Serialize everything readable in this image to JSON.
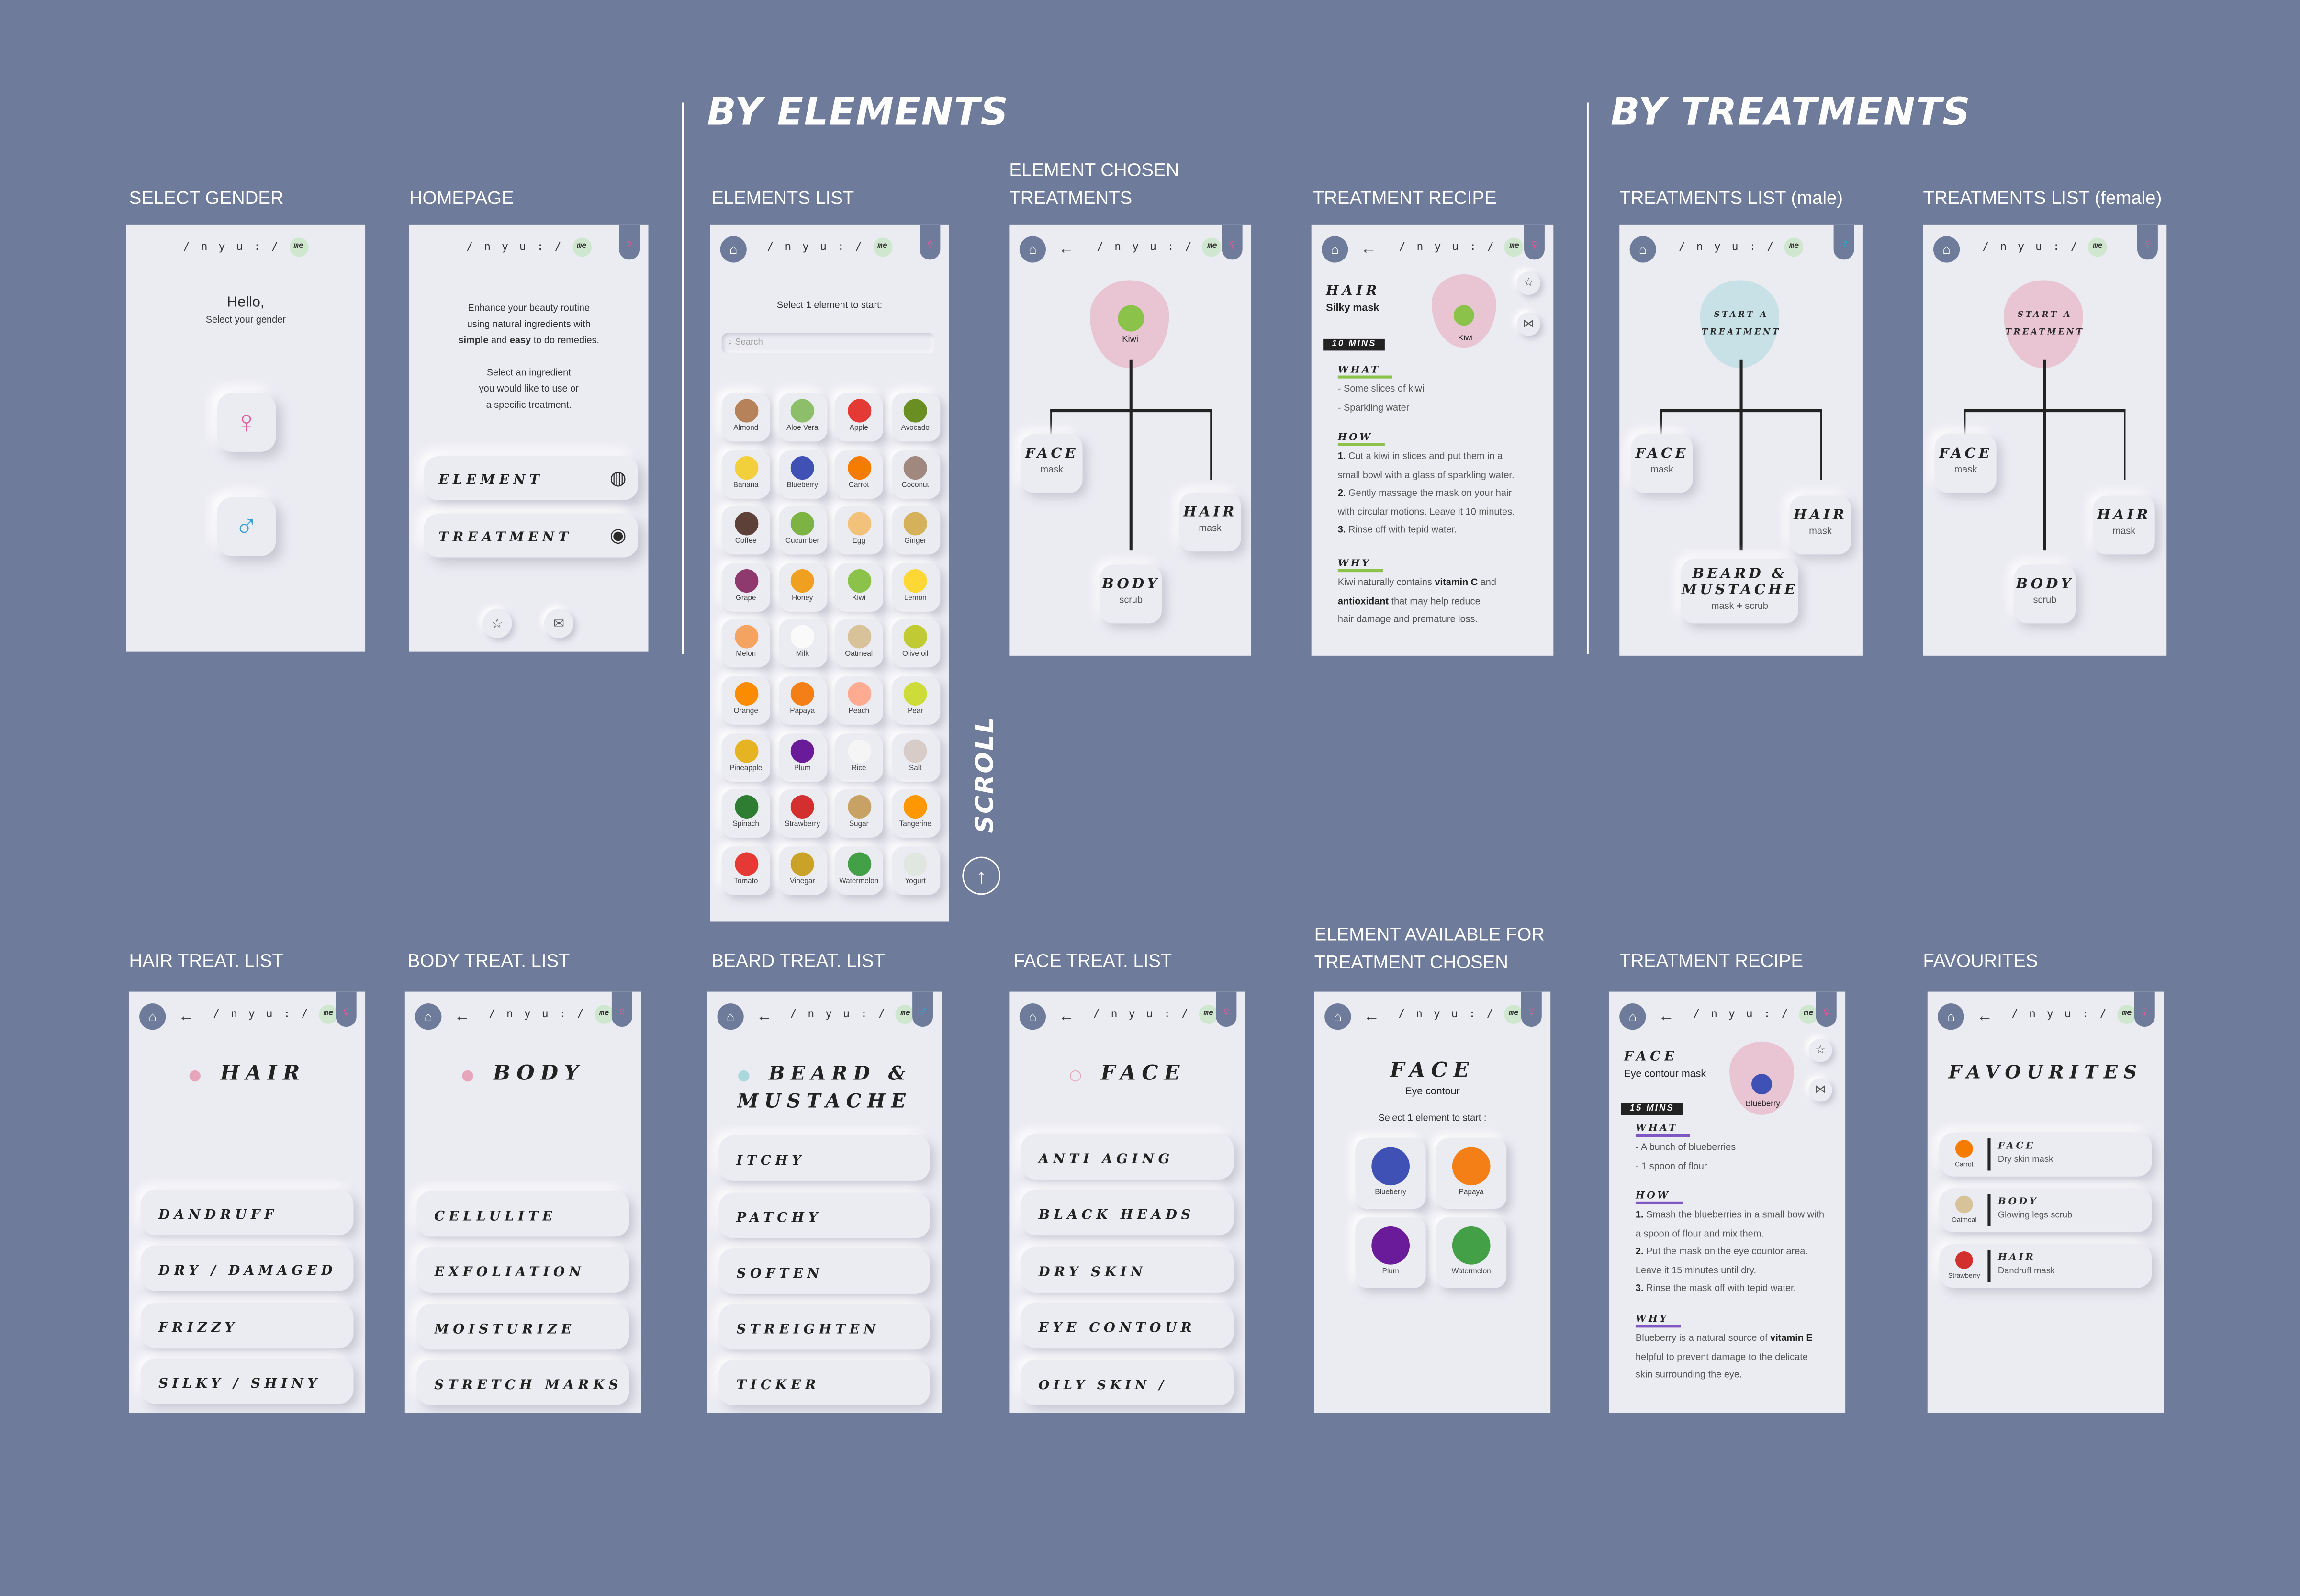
{
  "sections": {
    "by_elements": "BY ELEMENTS",
    "by_treatments": "BY TREATMENTS",
    "scroll": "SCROLL"
  },
  "captions": {
    "select_gender": "SELECT GENDER",
    "homepage": "HOMEPAGE",
    "elements_list": "ELEMENTS LIST",
    "element_chosen": "ELEMENT CHOSEN TREATMENTS",
    "recipe": "TREATMENT RECIPE",
    "treat_male": "TREATMENTS LIST (male)",
    "treat_female": "TREATMENTS LIST (female)",
    "hair_list": "HAIR TREAT. LIST",
    "body_list": "BODY TREAT. LIST",
    "beard_list": "BEARD TREAT. LIST",
    "face_list": "FACE TREAT. LIST",
    "element_available": "ELEMENT AVAILABLE FOR TREATMENT CHOSEN",
    "recipe2": "TREATMENT RECIPE",
    "favourites": "FAVOURITES"
  },
  "logo": {
    "left": "/ n y u : /",
    "right": "me"
  },
  "icons": {
    "home": "home-icon",
    "back": "arrow-left-icon",
    "female": "female-icon",
    "male": "male-icon",
    "star": "star-icon",
    "mail": "mail-icon",
    "share": "share-icon",
    "search": "search-icon",
    "eye": "eye-icon",
    "arrow_up": "arrow-up-icon"
  },
  "colors": {
    "background": "#6f7b9a",
    "screen": "#ebebf2",
    "female": "#e35b9a",
    "male": "#3b9fd1",
    "accent": "#8bc34a"
  },
  "gender": {
    "hello": "Hello,",
    "prompt": "Select your gender",
    "female": "♀",
    "male": "♂"
  },
  "home": {
    "intro1": "Enhance your beauty routine",
    "intro2": "using natural ingredients with",
    "intro3_b1": "simple",
    "intro3_m": "and",
    "intro3_b2": "easy",
    "intro3_e": "to do remedies.",
    "intro4": "Select an ingredient",
    "intro5": "you would like to use or",
    "intro6": "a specific treatment.",
    "element": "ELEMENT",
    "treatment": "TREATMENT"
  },
  "elements": {
    "prompt_a": "Select",
    "prompt_n": "1",
    "prompt_b": "element to start:",
    "search": "Search",
    "items": [
      {
        "n": "Almond",
        "c": "#b5825a"
      },
      {
        "n": "Aloe Vera",
        "c": "#8dbf6a"
      },
      {
        "n": "Apple",
        "c": "#e53935"
      },
      {
        "n": "Avocado",
        "c": "#6b8e23"
      },
      {
        "n": "Banana",
        "c": "#f2d03b"
      },
      {
        "n": "Blueberry",
        "c": "#3f51b5"
      },
      {
        "n": "Carrot",
        "c": "#f57c00"
      },
      {
        "n": "Coconut",
        "c": "#a1887f"
      },
      {
        "n": "Coffee",
        "c": "#5d4037"
      },
      {
        "n": "Cucumber",
        "c": "#7cb342"
      },
      {
        "n": "Egg",
        "c": "#f2c27b"
      },
      {
        "n": "Ginger",
        "c": "#d4b15a"
      },
      {
        "n": "Grape",
        "c": "#8e3a6e"
      },
      {
        "n": "Honey",
        "c": "#f0a020"
      },
      {
        "n": "Kiwi",
        "c": "#8bc34a"
      },
      {
        "n": "Lemon",
        "c": "#fdd835"
      },
      {
        "n": "Melon",
        "c": "#f4a460"
      },
      {
        "n": "Milk",
        "c": "#fafafa"
      },
      {
        "n": "Oatmeal",
        "c": "#d7c29a"
      },
      {
        "n": "Olive oil",
        "c": "#c0ca33"
      },
      {
        "n": "Orange",
        "c": "#fb8c00"
      },
      {
        "n": "Papaya",
        "c": "#f57f17"
      },
      {
        "n": "Peach",
        "c": "#ffab91"
      },
      {
        "n": "Pear",
        "c": "#cddc39"
      },
      {
        "n": "Pineapple",
        "c": "#e6b422"
      },
      {
        "n": "Plum",
        "c": "#6a1b9a"
      },
      {
        "n": "Rice",
        "c": "#f5f5f5"
      },
      {
        "n": "Salt",
        "c": "#d7ccc8"
      },
      {
        "n": "Spinach",
        "c": "#2e7d32"
      },
      {
        "n": "Strawberry",
        "c": "#d32f2f"
      },
      {
        "n": "Sugar",
        "c": "#c8a165"
      },
      {
        "n": "Tangerine",
        "c": "#ff9800"
      },
      {
        "n": "Tomato",
        "c": "#e53935"
      },
      {
        "n": "Vinegar",
        "c": "#c9a227"
      },
      {
        "n": "Watermelon",
        "c": "#43a047"
      },
      {
        "n": "Yogurt",
        "c": "#e0e6e0"
      }
    ]
  },
  "chosen": {
    "kiwi": "Kiwi",
    "face": "FACE",
    "face_sub": "mask",
    "hair": "HAIR",
    "hair_sub": "mask",
    "body": "BODY",
    "body_sub": "scrub"
  },
  "recipe": {
    "title": "HAIR",
    "sub": "Silky mask",
    "mins": "10 MINS",
    "kiwi": "Kiwi",
    "what": "WHAT",
    "what1": "- Some slices of kiwi",
    "what2": "- Sparkling water",
    "how": "HOW",
    "h1n": "1.",
    "h1a": "Cut a kiwi in slices and put them in a",
    "h1b": "small bowl with a glass of sparkling water.",
    "h2n": "2.",
    "h2a": "Gently massage the mask on your hair",
    "h2b": "with circular motions. Leave it 10 minutes.",
    "h3n": "3.",
    "h3a": "Rinse off with tepid water.",
    "why": "WHY",
    "w1a": "Kiwi naturally contains",
    "w1b": "vitamin C",
    "w1c": "and",
    "w2a": "antioxidant",
    "w2b": "that may help reduce",
    "w3": "hair damage and premature loss."
  },
  "treat": {
    "start1": "START A",
    "start2": "TREATMENT",
    "face": "FACE",
    "face_sub": "mask",
    "hair": "HAIR",
    "hair_sub": "mask",
    "beard1": "BEARD &",
    "beard2": "MUSTACHE",
    "beard_sub_a": "mask",
    "beard_sub_plus": "+",
    "beard_sub_b": "scrub",
    "body": "BODY",
    "body_sub": "scrub"
  },
  "hairlist": {
    "title": "HAIR",
    "items": [
      "DANDRUFF",
      "DRY / DAMAGED",
      "FRIZZY",
      "SILKY / SHINY"
    ]
  },
  "bodylist": {
    "title": "BODY",
    "items": [
      "CELLULITE",
      "EXFOLIATION",
      "MOISTURIZE",
      "STRETCH MARKS"
    ]
  },
  "beardlist": {
    "title1": "BEARD &",
    "title2": "MUSTACHE",
    "items": [
      "ITCHY",
      "PATCHY",
      "SOFTEN",
      "STREIGHTEN",
      "TICKER"
    ]
  },
  "facelist": {
    "title": "FACE",
    "items": [
      "ANTI AGING",
      "BLACK HEADS",
      "DRY SKIN",
      "EYE CONTOUR",
      "OILY SKIN / PIMPLES"
    ]
  },
  "avail": {
    "title": "FACE",
    "sub": "Eye contour",
    "prompt_a": "Select",
    "prompt_n": "1",
    "prompt_b": "element to start :",
    "items": [
      {
        "n": "Blueberry",
        "c": "#3f51b5"
      },
      {
        "n": "Papaya",
        "c": "#f57f17"
      },
      {
        "n": "Plum",
        "c": "#6a1b9a"
      },
      {
        "n": "Watermelon",
        "c": "#43a047"
      }
    ]
  },
  "recipe2": {
    "title": "FACE",
    "sub": "Eye contour mask",
    "mins": "15 MINS",
    "blueberry": "Blueberry",
    "what": "WHAT",
    "what1": "- A bunch of blueberries",
    "what2": "- 1 spoon of flour",
    "how": "HOW",
    "h1n": "1.",
    "h1a": "Smash the blueberries in a small bow with",
    "h1b": "a spoon of flour and mix them.",
    "h2n": "2.",
    "h2a": "Put the mask on the eye countor area.",
    "h2b": "Leave it 15 minutes until dry.",
    "h3n": "3.",
    "h3a": "Rinse the mask off with tepid water.",
    "why": "WHY",
    "w1a": "Blueberry is a natural source of",
    "w1b": "vitamin E",
    "w2": "helpful to prevent damage to the delicate",
    "w3": "skin surrounding the eye."
  },
  "fav": {
    "title": "FAVOURITES",
    "items": [
      {
        "el": "Carrot",
        "c": "#f57c00",
        "t": "FACE",
        "s": "Dry skin mask"
      },
      {
        "el": "Oatmeal",
        "c": "#d7c29a",
        "t": "BODY",
        "s": "Glowing legs scrub"
      },
      {
        "el": "Strawberry",
        "c": "#d32f2f",
        "t": "HAIR",
        "s": "Dandruff mask"
      }
    ]
  }
}
